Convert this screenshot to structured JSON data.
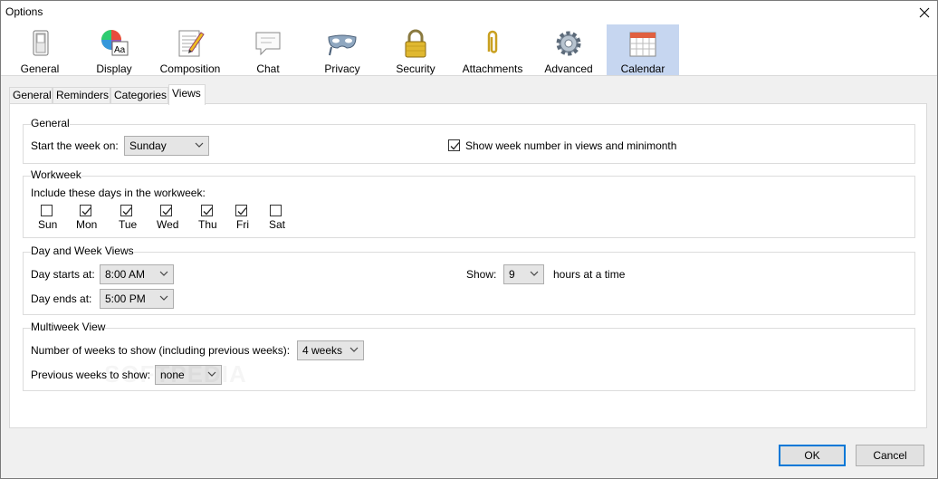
{
  "window": {
    "title": "Options"
  },
  "toolbar": {
    "items": [
      {
        "label": "General",
        "icon": "switch-icon"
      },
      {
        "label": "Display",
        "icon": "color-wheel-font-icon"
      },
      {
        "label": "Composition",
        "icon": "notepad-pen-icon"
      },
      {
        "label": "Chat",
        "icon": "speech-bubble-icon"
      },
      {
        "label": "Privacy",
        "icon": "mask-icon"
      },
      {
        "label": "Security",
        "icon": "padlock-icon"
      },
      {
        "label": "Attachments",
        "icon": "paperclip-icon"
      },
      {
        "label": "Advanced",
        "icon": "gear-icon"
      },
      {
        "label": "Calendar",
        "icon": "calendar-icon"
      }
    ],
    "active": "Calendar",
    "accent": "#c6d6f0"
  },
  "tabs": [
    "General",
    "Reminders",
    "Categories",
    "Views"
  ],
  "active_tab": "Views",
  "general": {
    "title": "General",
    "start_week_label": "Start the week on:",
    "start_week_value": "Sunday",
    "show_week_number_label": "Show week number in views and minimonth",
    "show_week_number_checked": true
  },
  "workweek": {
    "title": "Workweek",
    "include_label": "Include these days in the workweek:",
    "days": [
      {
        "label": "Sun",
        "checked": false
      },
      {
        "label": "Mon",
        "checked": true
      },
      {
        "label": "Tue",
        "checked": true
      },
      {
        "label": "Wed",
        "checked": true
      },
      {
        "label": "Thu",
        "checked": true
      },
      {
        "label": "Fri",
        "checked": true
      },
      {
        "label": "Sat",
        "checked": false
      }
    ]
  },
  "dayweek": {
    "title": "Day and Week Views",
    "day_starts_label": "Day starts at:",
    "day_starts_value": "8:00 AM",
    "day_ends_label": "Day ends at:",
    "day_ends_value": "5:00 PM",
    "show_label": "Show:",
    "show_value": "9",
    "hours_label": "hours at a time"
  },
  "multiweek": {
    "title": "Multiweek View",
    "weeks_label": "Number of weeks to show (including previous weeks):",
    "weeks_value": "4 weeks",
    "previous_label": "Previous weeks to show:",
    "previous_value": "none"
  },
  "buttons": {
    "ok": "OK",
    "cancel": "Cancel"
  },
  "watermark": "SOFTPEDIA"
}
